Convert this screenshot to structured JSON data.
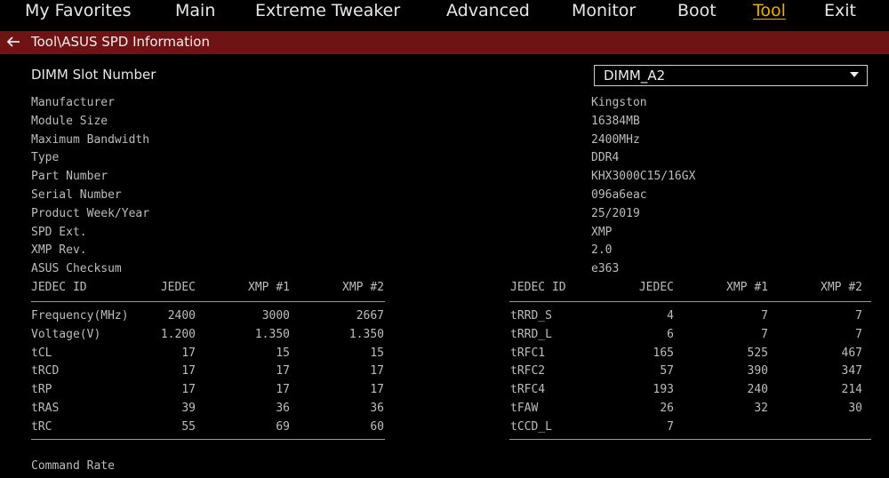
{
  "nav": {
    "items": [
      "My Favorites",
      "Main",
      "Extreme Tweaker",
      "Advanced",
      "Monitor",
      "Boot",
      "Tool",
      "Exit"
    ],
    "active": "Tool",
    "active_color": "#e8b000"
  },
  "breadcrumb": {
    "back_icon": "arrow-left-icon",
    "path": "Tool\\ASUS SPD Information",
    "bar_color": "#6e1414"
  },
  "slot": {
    "label": "DIMM Slot Number",
    "selected": "DIMM_A2"
  },
  "info": [
    {
      "label": "Manufacturer",
      "value": "Kingston"
    },
    {
      "label": "Module Size",
      "value": "16384MB"
    },
    {
      "label": "Maximum Bandwidth",
      "value": "2400MHz"
    },
    {
      "label": "Type",
      "value": "DDR4"
    },
    {
      "label": "Part Number",
      "value": "KHX3000C15/16GX"
    },
    {
      "label": "Serial Number",
      "value": "096a6eac"
    },
    {
      "label": "Product Week/Year",
      "value": "25/2019"
    },
    {
      "label": "SPD Ext.",
      "value": "XMP"
    },
    {
      "label": "XMP Rev.",
      "value": "2.0"
    },
    {
      "label": "ASUS Checksum",
      "value": "e363"
    }
  ],
  "left_table": {
    "headers": [
      "JEDEC ID",
      "JEDEC",
      "XMP #1",
      "XMP #2"
    ],
    "rows": [
      [
        "Frequency(MHz)",
        "2400",
        "3000",
        "2667"
      ],
      [
        "Voltage(V)",
        "1.200",
        "1.350",
        "1.350"
      ],
      [
        "tCL",
        "17",
        "15",
        "15"
      ],
      [
        "tRCD",
        "17",
        "17",
        "17"
      ],
      [
        "tRP",
        "17",
        "17",
        "17"
      ],
      [
        "tRAS",
        "39",
        "36",
        "36"
      ],
      [
        "tRC",
        "55",
        "69",
        "60"
      ]
    ]
  },
  "right_table": {
    "headers": [
      "JEDEC ID",
      "JEDEC",
      "XMP #1",
      "XMP #2"
    ],
    "rows": [
      [
        "tRRD_S",
        "4",
        "7",
        "7"
      ],
      [
        "tRRD_L",
        "6",
        "7",
        "7"
      ],
      [
        "tRFC1",
        "165",
        "525",
        "467"
      ],
      [
        "tRFC2",
        "57",
        "390",
        "347"
      ],
      [
        "tRFC4",
        "193",
        "240",
        "214"
      ],
      [
        "tFAW",
        "26",
        "32",
        "30"
      ],
      [
        "tCCD_L",
        "7",
        "",
        ""
      ]
    ]
  },
  "command_rate_label": "Command Rate"
}
